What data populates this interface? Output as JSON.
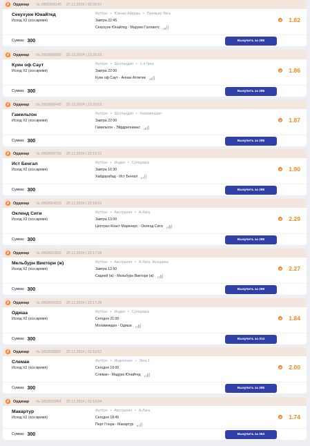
{
  "currency_badge": "₽",
  "colors": {
    "accent": "#ff7a1a",
    "odds": "#f08a1c",
    "button": "#3140a8",
    "header_bg": "#f3e6dc"
  },
  "sum_label": "Сумма:",
  "bets": [
    {
      "type": "Ординар",
      "number": "№ 2895309145",
      "date": "27.12.2024 | 00:39:37",
      "team": "Секухуне Юнайтед",
      "market": "Исход Х2 (осн.время)",
      "sport": "Футбол",
      "country": "Южная Африка",
      "league": "Премьер Лига",
      "when": "Завтра 22:45",
      "match": "Секухуне Юнайтед - Марумо Галлантс",
      "odds": "1.82",
      "sum": "300",
      "cashout": "Выкупить за 285"
    },
    {
      "type": "Ординар",
      "number": "№ 2892668855",
      "date": "25.12.2024 | 23:20:33",
      "team": "Куин оф Саут",
      "market": "Исход Х2 (осн.время)",
      "sport": "Футбол",
      "country": "Шотландия",
      "league": "1-я Лига",
      "when": "Завтра 22:00",
      "match": "Куин оф Саут - Аннан Атлетик",
      "odds": "1.86",
      "sum": "300",
      "cashout": "Выкупить за 285"
    },
    {
      "type": "Ординар",
      "number": "№ 2892668445",
      "date": "25.12.2024 | 23:20:02",
      "team": "Гамильтон",
      "market": "Исход Х2 (осн.время)",
      "sport": "Футбол",
      "country": "Шотландия",
      "league": "Чемпионшип",
      "when": "Завтра 22:00",
      "match": "Гамильтон - Эйрдрионианс",
      "odds": "1.87",
      "sum": "300",
      "cashout": "Выкупить за 285"
    },
    {
      "type": "Ординар",
      "number": "№ 2892666709",
      "date": "25.12.2024 | 23:19:32",
      "team": "Ист Бенгал",
      "market": "Исход Х2 (осн.время)",
      "sport": "Футбол",
      "country": "Индия",
      "league": "Суперлига",
      "when": "Завтра 16:30",
      "match": "Хайдарабад - Ист Бенгал",
      "odds": "1.90",
      "sum": "300",
      "cashout": "Выкупить за 285"
    },
    {
      "type": "Ординар",
      "number": "№ 2892664633",
      "date": "25.12.2024 | 23:18:51",
      "team": "Окленд Сити",
      "market": "Исход Х2 (осн.время)",
      "sport": "Футбол",
      "country": "Австралия",
      "league": "А-Лига",
      "when": "Завтра 13:00",
      "match": "Централ Коаст Маринерс - Окленд Сити",
      "odds": "2.29",
      "sum": "300",
      "cashout": "Выкупить за 285"
    },
    {
      "type": "Ординар",
      "number": "№ 2892661822",
      "date": "25.12.2024 | 23:17:58",
      "team": "Мельбурн Виктори (ж)",
      "market": "Исход Х2 (осн.время)",
      "sport": "Футбол",
      "country": "Австралия",
      "league": "А-Лига, Женщины",
      "when": "Завтра 12:50",
      "match": "Сидней (ж) - Мельбурн Виктори (ж)",
      "odds": "2.27",
      "sum": "300",
      "cashout": "Выкупить за 269"
    },
    {
      "type": "Ординар",
      "number": "№ 2892660323",
      "date": "25.12.2024 | 23:17:25",
      "team": "Одиша",
      "market": "Исход Х2 (осн.время)",
      "sport": "Футбол",
      "country": "Индия",
      "league": "Суперлига",
      "when": "Сегодня 21:00",
      "match": "Мохаммедан - Одиша",
      "odds": "1.84",
      "sum": "300",
      "cashout": "Выкупить за 314"
    },
    {
      "type": "Ординар",
      "number": "№ 2892658897",
      "date": "25.12.2024 | 23:16:52",
      "team": "Слеман",
      "market": "Исход Х2 (осн.время)",
      "sport": "Футбол",
      "country": "Индонезия",
      "league": "Лига 1",
      "when": "Сегодня 19:00",
      "match": "Слеман - Мадура Юнайтед",
      "odds": "2.00",
      "sum": "300",
      "cashout": "Выкупить за 285"
    },
    {
      "type": "Ординар",
      "number": "№ 2892656854",
      "date": "25.12.2024 | 23:16:04",
      "team": "Макартур",
      "market": "Исход Х2 (осн.время)",
      "sport": "Футбол",
      "country": "Австралия",
      "league": "А-Лига",
      "when": "Сегодня 18:45",
      "match": "Перт Глори - Макартур",
      "odds": "1.74",
      "sum": "300",
      "cashout": "Выкупить за 263"
    }
  ]
}
